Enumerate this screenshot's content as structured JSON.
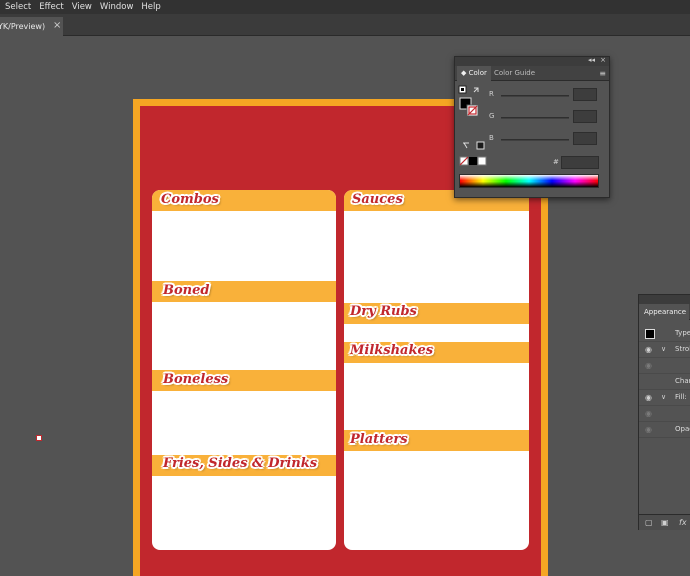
{
  "menu": {
    "items": [
      "Select",
      "Effect",
      "View",
      "Window",
      "Help"
    ]
  },
  "document_tab": {
    "title": "YK/Preview)",
    "close": "×"
  },
  "artboard": {
    "colors": {
      "border": "#f5a623",
      "background": "#c1272d",
      "band": "#f9b13a",
      "card": "#ffffff"
    },
    "left_column": {
      "sections": [
        "Combos",
        "Boned",
        "Boneless",
        "Fries, Sides & Drinks"
      ]
    },
    "right_column": {
      "sections": [
        "Sauces",
        "Dry Rubs",
        "Milkshakes",
        "Platters"
      ]
    }
  },
  "color_panel": {
    "tabs": [
      "Color",
      "Color Guide"
    ],
    "active_tab": "Color",
    "channels": [
      "R",
      "G",
      "B"
    ],
    "hex_prefix": "#",
    "collapse_glyph": "◂◂",
    "close_glyph": "×",
    "menu_glyph": "≡"
  },
  "appearance_panel": {
    "tab": "Appearance",
    "rows": [
      "Type",
      "Stroke",
      "Characters",
      "Fill:",
      "Opacity"
    ],
    "footer_fx": "fx"
  }
}
